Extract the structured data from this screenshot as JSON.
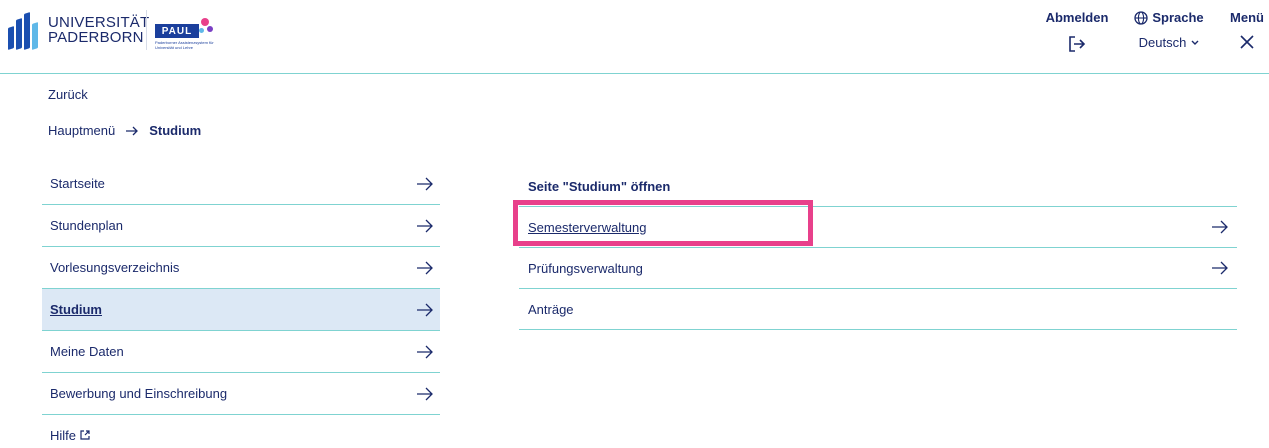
{
  "brand": {
    "university_line1": "UNIVERSITÄT",
    "university_line2": "PADERBORN",
    "paul_name": "PAUL",
    "paul_sub": "Paderborner Assistenzsystem für Universität und Lehre",
    "colors": {
      "primary": "#1b2a6b",
      "divider": "#7fd3d1",
      "active_bg": "#dce8f5",
      "highlight": "#e8408b"
    }
  },
  "header": {
    "logout_label": "Abmelden",
    "logout_icon": "logout-icon",
    "language_label": "Sprache",
    "language_icon": "globe-icon",
    "language_value": "Deutsch",
    "menu_label": "Menü",
    "menu_icon": "close-icon"
  },
  "nav": {
    "back_label": "Zurück",
    "breadcrumb": {
      "root": "Hauptmenü",
      "current": "Studium"
    }
  },
  "leftnav": {
    "items": [
      {
        "label": "Startseite"
      },
      {
        "label": "Stundenplan"
      },
      {
        "label": "Vorlesungsverzeichnis"
      },
      {
        "label": "Studium",
        "active": true
      },
      {
        "label": "Meine Daten"
      },
      {
        "label": "Bewerbung und Einschreibung"
      }
    ],
    "help_label": "Hilfe"
  },
  "submenu": {
    "title": "Seite \"Studium\" öffnen",
    "items": [
      {
        "label": "Semesterverwaltung",
        "has_arrow": true
      },
      {
        "label": "Prüfungsverwaltung",
        "has_arrow": true
      },
      {
        "label": "Anträge",
        "has_arrow": false
      }
    ]
  }
}
